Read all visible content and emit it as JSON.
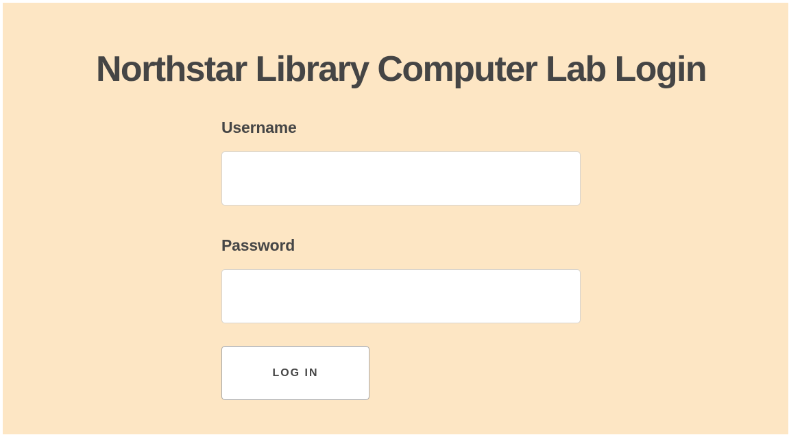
{
  "page": {
    "title": "Northstar Library Computer Lab Login",
    "background_color": "#fde6c4"
  },
  "form": {
    "username_label": "Username",
    "username_value": "",
    "password_label": "Password",
    "password_value": "",
    "submit_label": "LOG IN"
  }
}
